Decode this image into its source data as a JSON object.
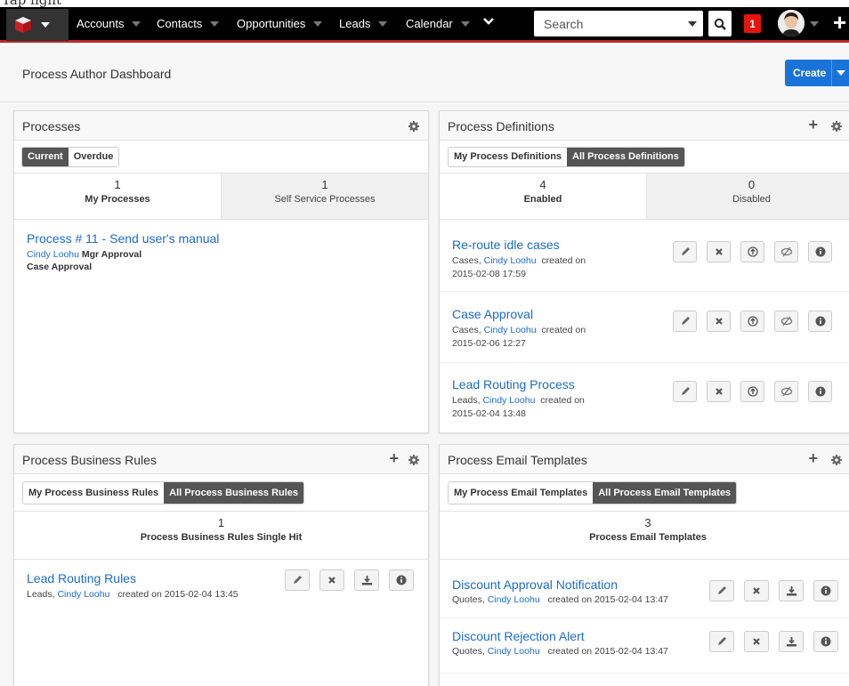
{
  "nav": {
    "items": [
      {
        "label": "Accounts"
      },
      {
        "label": "Contacts"
      },
      {
        "label": "Opportunities"
      },
      {
        "label": "Leads"
      },
      {
        "label": "Calendar"
      }
    ],
    "search_placeholder": "Search",
    "notification_count": "1"
  },
  "header": {
    "title": "Process Author Dashboard",
    "create_label": "Create"
  },
  "processes": {
    "title": "Processes",
    "seg": [
      "Current",
      "Overdue"
    ],
    "tabs": [
      {
        "count": "1",
        "label": "My Processes"
      },
      {
        "count": "1",
        "label": "Self Service Processes"
      }
    ],
    "item": {
      "title": "Process  # 11 -  Send user's manual",
      "user": "Cindy Loohu",
      "task": "Mgr Approval",
      "def": "Case Approval"
    }
  },
  "definitions": {
    "title": "Process Definitions",
    "seg": [
      "My Process Definitions",
      "All Process Definitions"
    ],
    "tabs": [
      {
        "count": "4",
        "label": "Enabled"
      },
      {
        "count": "0",
        "label": "Disabled"
      }
    ],
    "items": [
      {
        "title": "Re-route idle cases",
        "module": "Cases,",
        "user": "Cindy Loohu",
        "created": "created on",
        "date": "2015-02-08 17:59"
      },
      {
        "title": "Case Approval",
        "module": "Cases,",
        "user": "Cindy Loohu",
        "created": "created on",
        "date": "2015-02-06 12:27"
      },
      {
        "title": "Lead Routing Process",
        "module": "Leads,",
        "user": "Cindy Loohu",
        "created": "created on",
        "date": "2015-02-04 13:48"
      }
    ]
  },
  "rules": {
    "title": "Process Business Rules",
    "seg": [
      "My Process Business Rules",
      "All Process Business Rules"
    ],
    "count": "1",
    "label": "Process Business Rules Single Hit",
    "items": [
      {
        "title": "Lead Routing Rules",
        "module": "Leads,",
        "user": "Cindy Loohu",
        "created": "created on 2015-02-04 13:45"
      }
    ]
  },
  "emails": {
    "title": "Process Email Templates",
    "seg": [
      "My Process Email Templates",
      "All Process Email Templates"
    ],
    "count": "3",
    "label": "Process Email Templates",
    "items": [
      {
        "title": "Discount Approval Notification",
        "module": "Quotes,",
        "user": "Cindy Loohu",
        "created": "created on 2015-02-04 13:47"
      },
      {
        "title": "Discount Rejection Alert",
        "module": "Quotes,",
        "user": "Cindy Loohu",
        "created": "created on 2015-02-04 13:47"
      }
    ]
  },
  "icons": {
    "logo": "cube-logo-icon",
    "search": "search-icon",
    "gear": "gear-icon",
    "plus": "plus-icon",
    "edit": "pencil-icon",
    "delete": "x-icon",
    "enable": "upload-circle-icon",
    "disable": "eye-slash-icon",
    "info": "info-icon",
    "download": "download-icon"
  },
  "colors": {
    "navbar": "#000000",
    "accent_red": "#c0262b",
    "link": "#1a6bd0",
    "create_button": "#1a73d9",
    "notification": "#e8140d"
  }
}
